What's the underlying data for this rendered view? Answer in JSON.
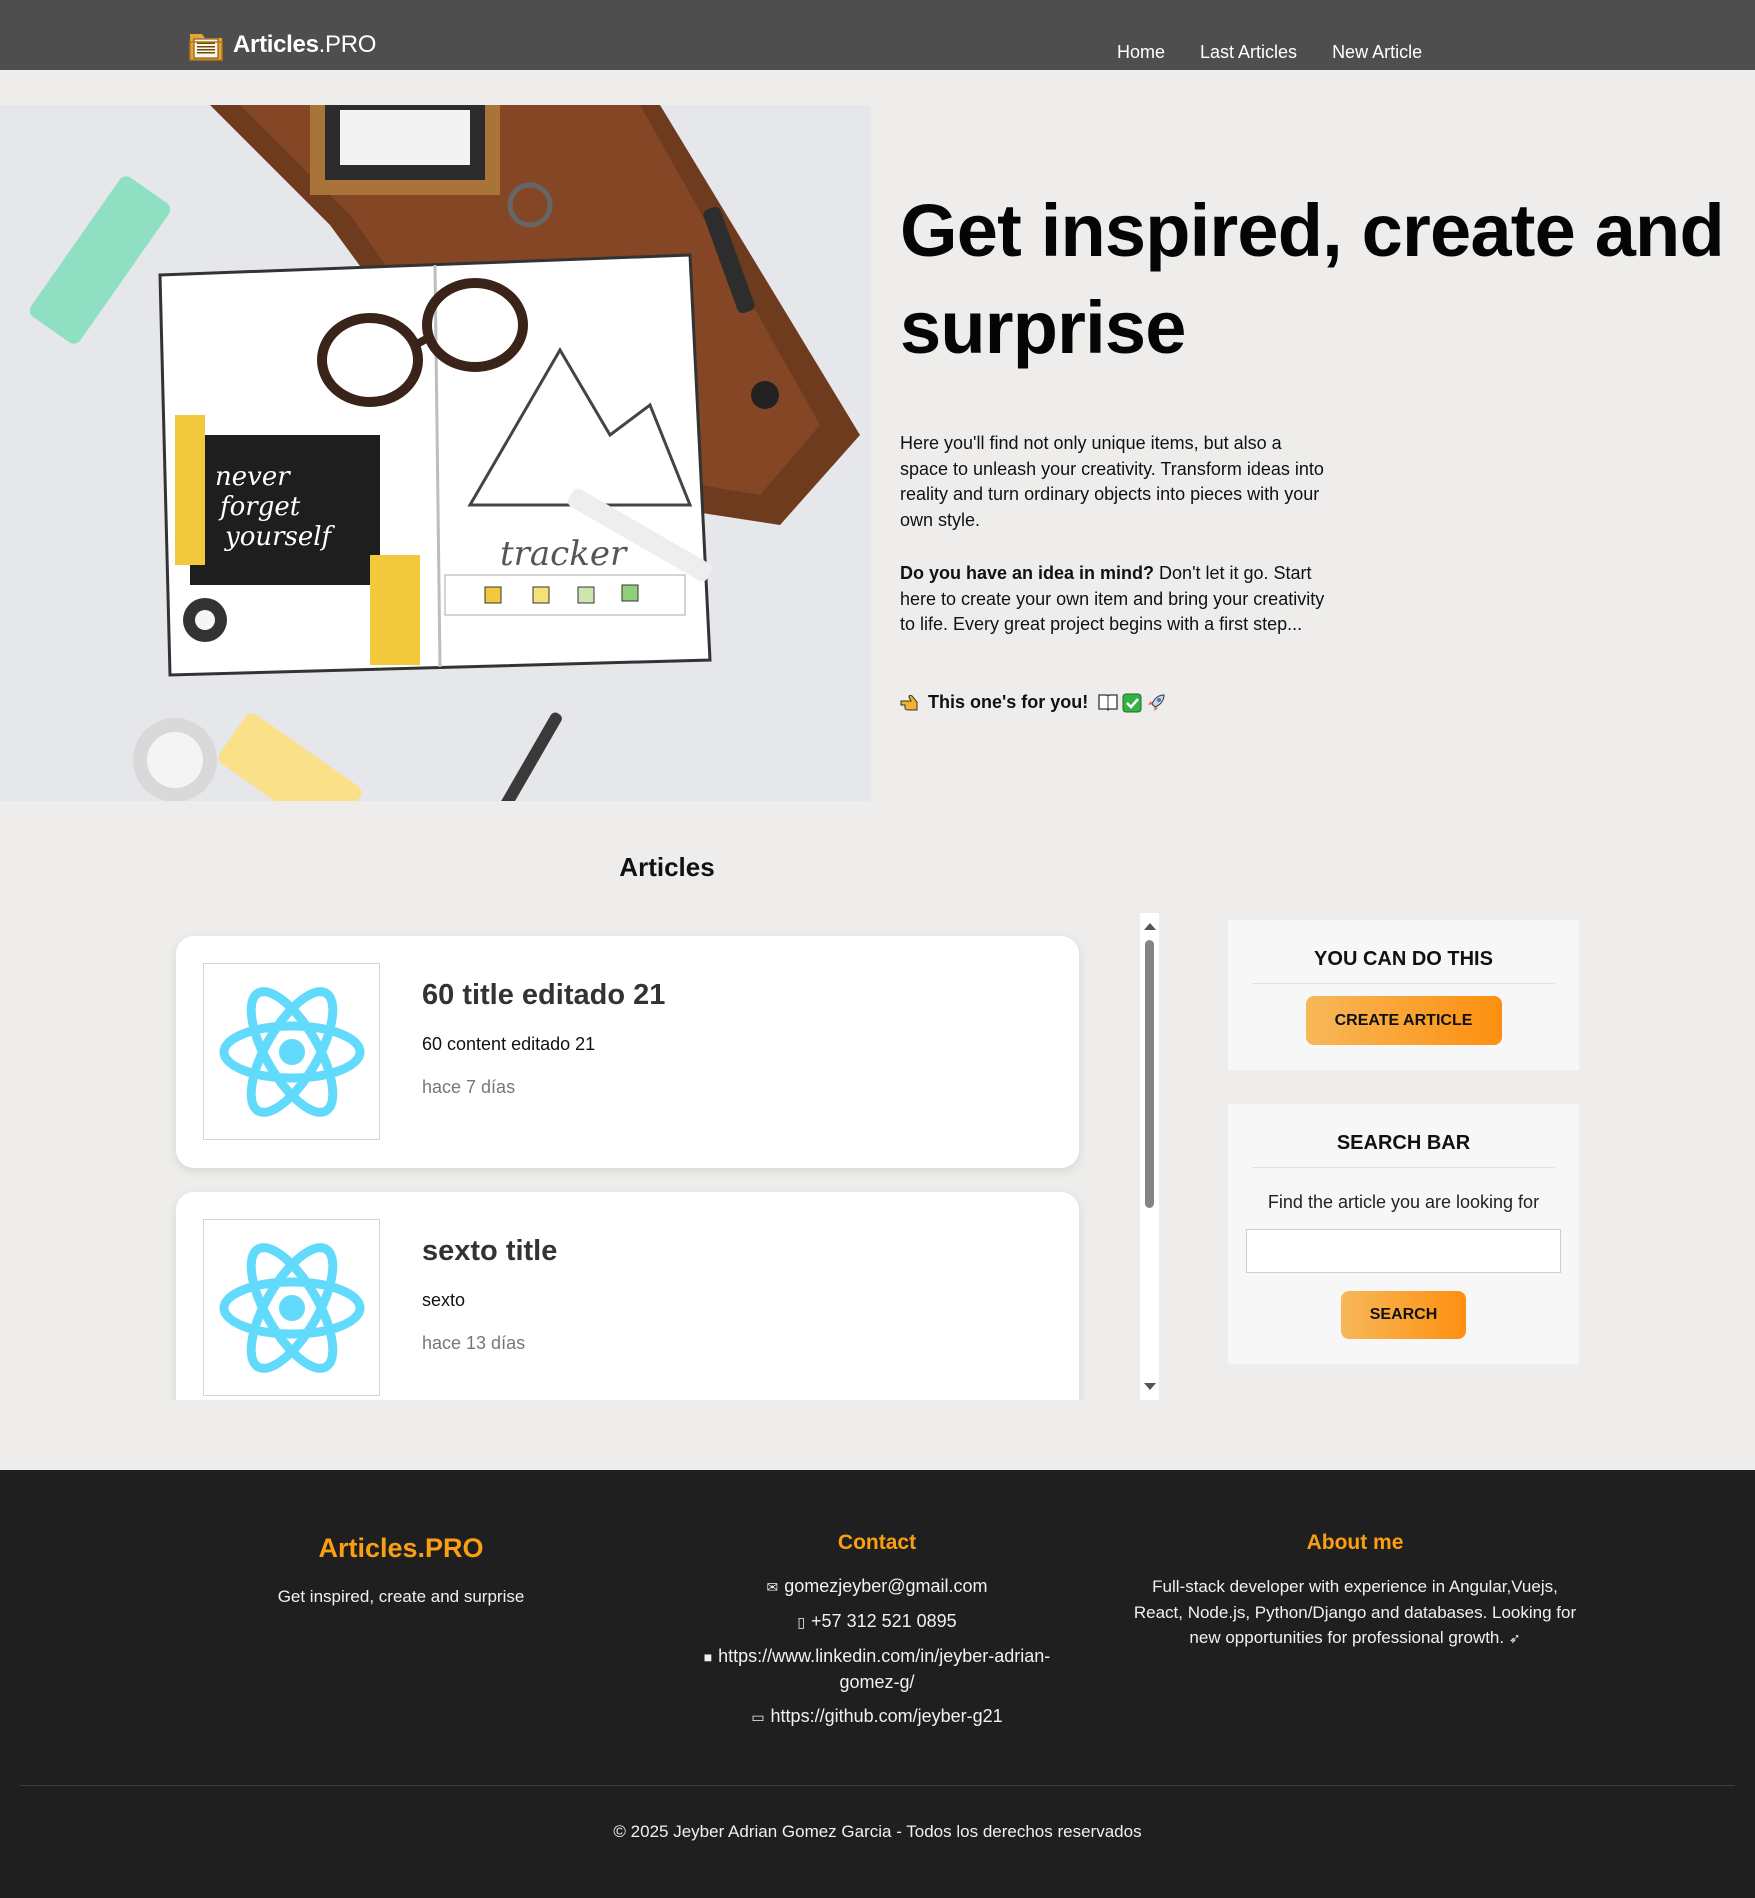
{
  "nav": {
    "brand_bold": "Articles",
    "brand_rest": ".PRO",
    "links": [
      "Home",
      "Last Articles",
      "New Article"
    ]
  },
  "hero": {
    "title": "Get inspired, create and surprise",
    "paragraph1": "Here you'll find not only unique items, but also a space to unleash your creativity. Transform ideas into reality and turn ordinary objects into pieces with your own style.",
    "paragraph2_bold": "Do you have an idea in mind?",
    "paragraph2_rest": " Don't let it go. Start here to create your own item and bring your creativity to life. Every great project begins with a first step...",
    "tagline": "This one's for you!",
    "tag_icons": [
      "pointing-hand-icon",
      "open-book-icon",
      "check-mark-icon",
      "rocket-icon"
    ]
  },
  "articles": {
    "heading": "Articles",
    "items": [
      {
        "title": "60 title editado 21",
        "content": "60 content editado 21",
        "date": "hace 7 días",
        "thumb_icon": "react-logo-icon"
      },
      {
        "title": "sexto title",
        "content": "sexto",
        "date": "hace 13 días",
        "thumb_icon": "react-logo-icon"
      }
    ]
  },
  "sidebar": {
    "create": {
      "title": "YOU CAN DO THIS",
      "button": "CREATE ARTICLE"
    },
    "search": {
      "title": "SEARCH BAR",
      "subtitle": "Find the article you are looking for",
      "input_value": "",
      "button": "SEARCH"
    }
  },
  "footer": {
    "brand": "Articles.PRO",
    "brand_sub": "Get inspired, create and surprise",
    "contact_title": "Contact",
    "contact": [
      {
        "icon": "envelope-icon",
        "text": "gomezjeyber@gmail.com"
      },
      {
        "icon": "phone-icon",
        "text": "+57 312 521 0895"
      },
      {
        "icon": "briefcase-icon",
        "text": "https://www.linkedin.com/in/jeyber-adrian-gomez-g/"
      },
      {
        "icon": "laptop-icon",
        "text": "https://github.com/jeyber-g21"
      }
    ],
    "about_title": "About me",
    "about": "Full-stack developer with experience in Angular,Vuejs, React, Node.js, Python/Django and databases. Looking for new opportunities for professional growth.",
    "copyright": "© 2025 Jeyber Adrian Gomez Garcia - Todos los derechos reservados"
  },
  "colors": {
    "nav_bg": "#4e4e4e",
    "page_bg": "#eeedeb",
    "accent_orange": "#fb9e12",
    "button_gradient_start": "#f7b859",
    "button_gradient_end": "#fd8f10",
    "footer_bg": "#1f1f1f",
    "react_blue": "#61dafb"
  }
}
